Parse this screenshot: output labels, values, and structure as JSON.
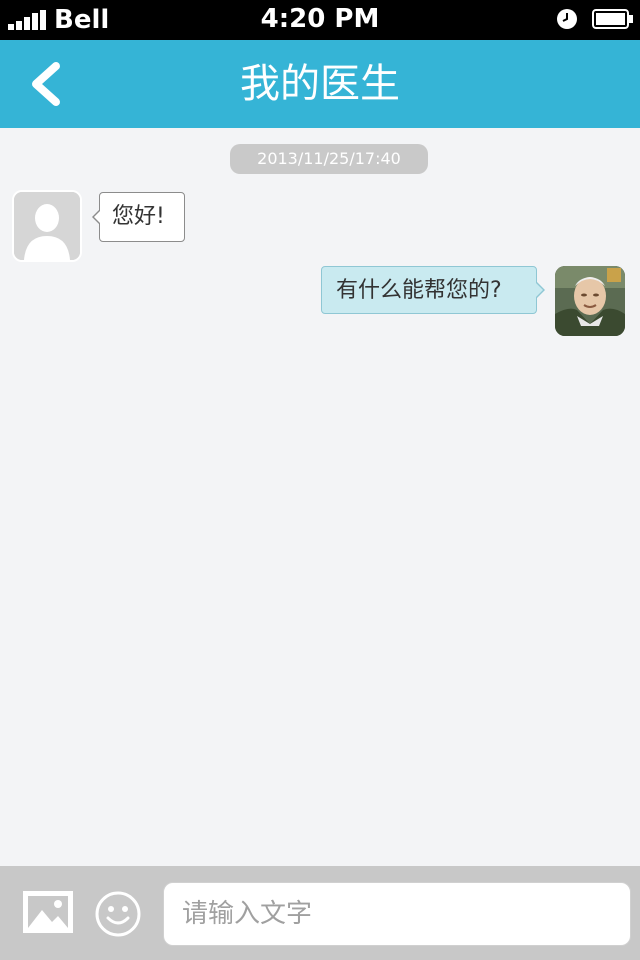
{
  "status_bar": {
    "carrier": "Bell",
    "time": "4:20 PM",
    "signal_icon": "signal-icon",
    "alarm_icon": "alarm-clock-icon",
    "battery_icon": "battery-icon"
  },
  "nav": {
    "title": "我的医生",
    "back_icon": "chevron-left-icon",
    "bar_color": "#35b4d6"
  },
  "chat": {
    "timestamp": "2013/11/25/17:40",
    "messages": [
      {
        "side": "left",
        "text": "您好!",
        "avatar": "default-user-icon"
      },
      {
        "side": "right",
        "text": "有什么能帮您的?",
        "avatar": "doctor-photo"
      }
    ]
  },
  "input_bar": {
    "placeholder": "请输入文字",
    "value": "",
    "image_icon": "image-icon",
    "emoji_icon": "smiley-icon"
  }
}
